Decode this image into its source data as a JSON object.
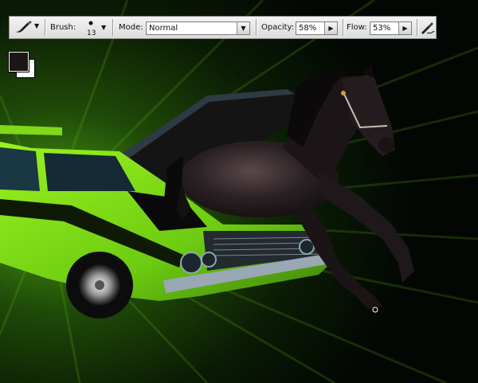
{
  "toolbar": {
    "brush_label": "Brush:",
    "brush_size": "13",
    "mode_label": "Mode:",
    "mode_value": "Normal",
    "opacity_label": "Opacity:",
    "opacity_value": "58%",
    "flow_label": "Flow:",
    "flow_value": "53%"
  },
  "icons": {
    "tool": "brush-tool-icon",
    "dropdown": "chevron-down-icon",
    "airbrush": "airbrush-icon",
    "flyout": "triangle-right-icon"
  },
  "colors": {
    "foreground": "#1c1716",
    "background": "#ffffff"
  }
}
